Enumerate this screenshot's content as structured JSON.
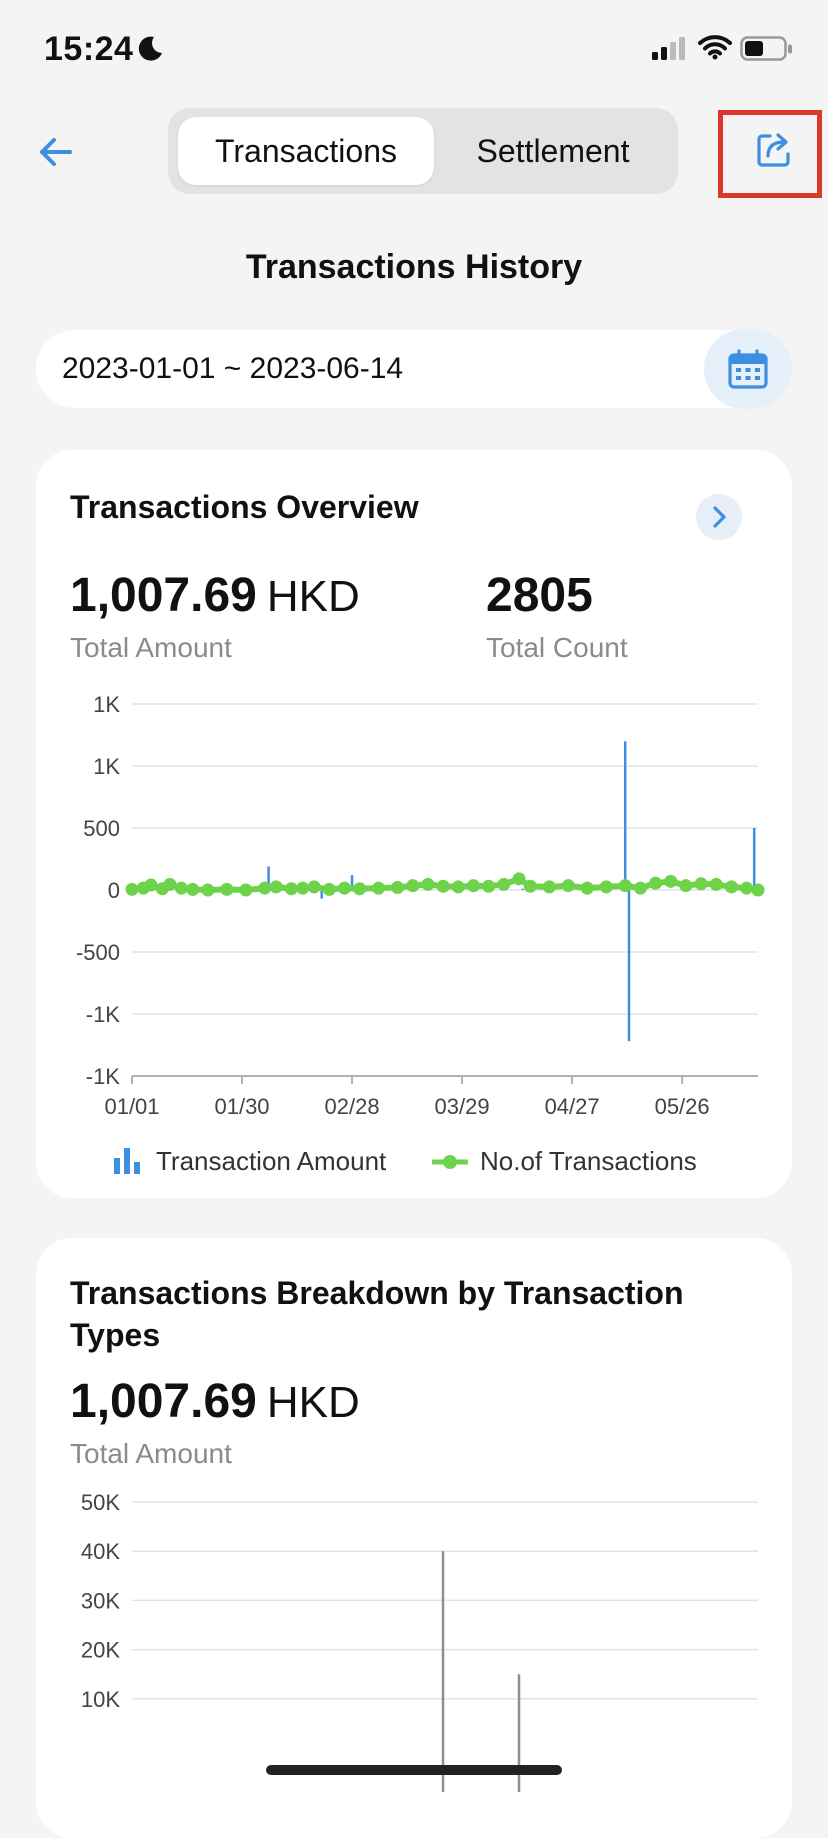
{
  "status_bar": {
    "time": "15:24"
  },
  "nav": {
    "tabs": [
      {
        "label": "Transactions",
        "active": true
      },
      {
        "label": "Settlement",
        "active": false
      }
    ]
  },
  "page_title": "Transactions History",
  "date_range": "2023-01-01 ~ 2023-06-14",
  "overview": {
    "title": "Transactions Overview",
    "total_amount_value": "1,007.69",
    "total_amount_unit": "HKD",
    "total_amount_label": "Total Amount",
    "total_count_value": "2805",
    "total_count_label": "Total Count",
    "legend": {
      "amount": "Transaction Amount",
      "count": "No.of Transactions"
    }
  },
  "breakdown": {
    "title": "Transactions Breakdown by Transaction Types",
    "total_amount_value": "1,007.69",
    "total_amount_unit": "HKD",
    "total_amount_label": "Total Amount"
  },
  "colors": {
    "accent": "#3d8fe0",
    "green": "#6cd34a",
    "highlight": "#d8392b"
  },
  "chart_data": [
    {
      "type": "bar",
      "y_tick_labels": [
        "1K",
        "1K",
        "500",
        "0",
        "-500",
        "-1K",
        "-1K"
      ],
      "y_ticks": [
        1500,
        1000,
        500,
        0,
        -500,
        -1000,
        -1500
      ],
      "x_tick_labels": [
        "01/01",
        "01/30",
        "02/28",
        "03/29",
        "04/27",
        "05/26"
      ],
      "x_range_days": [
        0,
        165
      ],
      "ylim": [
        -1500,
        1500
      ],
      "legend_position": "bottom",
      "series": [
        {
          "name": "Transaction Amount",
          "points": [
            [
              36,
              190
            ],
            [
              50,
              -70
            ],
            [
              58,
              120
            ],
            [
              103,
              10
            ],
            [
              130,
              1200
            ],
            [
              131,
              -1220
            ],
            [
              164,
              500
            ]
          ]
        },
        {
          "name": "No.of Transactions",
          "points": [
            [
              0,
              5
            ],
            [
              3,
              15
            ],
            [
              5,
              40
            ],
            [
              8,
              10
            ],
            [
              10,
              45
            ],
            [
              13,
              15
            ],
            [
              16,
              5
            ],
            [
              20,
              0
            ],
            [
              25,
              5
            ],
            [
              30,
              0
            ],
            [
              35,
              15
            ],
            [
              38,
              25
            ],
            [
              42,
              10
            ],
            [
              45,
              15
            ],
            [
              48,
              25
            ],
            [
              52,
              5
            ],
            [
              56,
              15
            ],
            [
              60,
              10
            ],
            [
              65,
              15
            ],
            [
              70,
              20
            ],
            [
              74,
              35
            ],
            [
              78,
              45
            ],
            [
              82,
              30
            ],
            [
              86,
              25
            ],
            [
              90,
              35
            ],
            [
              94,
              30
            ],
            [
              98,
              45
            ],
            [
              102,
              90
            ],
            [
              105,
              30
            ],
            [
              110,
              25
            ],
            [
              115,
              35
            ],
            [
              120,
              15
            ],
            [
              125,
              25
            ],
            [
              130,
              35
            ],
            [
              134,
              15
            ],
            [
              138,
              55
            ],
            [
              142,
              70
            ],
            [
              146,
              35
            ],
            [
              150,
              50
            ],
            [
              154,
              45
            ],
            [
              158,
              25
            ],
            [
              162,
              15
            ],
            [
              165,
              0
            ]
          ]
        }
      ]
    },
    {
      "type": "bar",
      "y_tick_labels": [
        "50K",
        "40K",
        "30K",
        "20K",
        "10K"
      ],
      "y_ticks": [
        50000,
        40000,
        30000,
        20000,
        10000
      ],
      "ylim": [
        0,
        50000
      ],
      "series": [
        {
          "values": [
            40000,
            15000
          ]
        }
      ]
    }
  ]
}
